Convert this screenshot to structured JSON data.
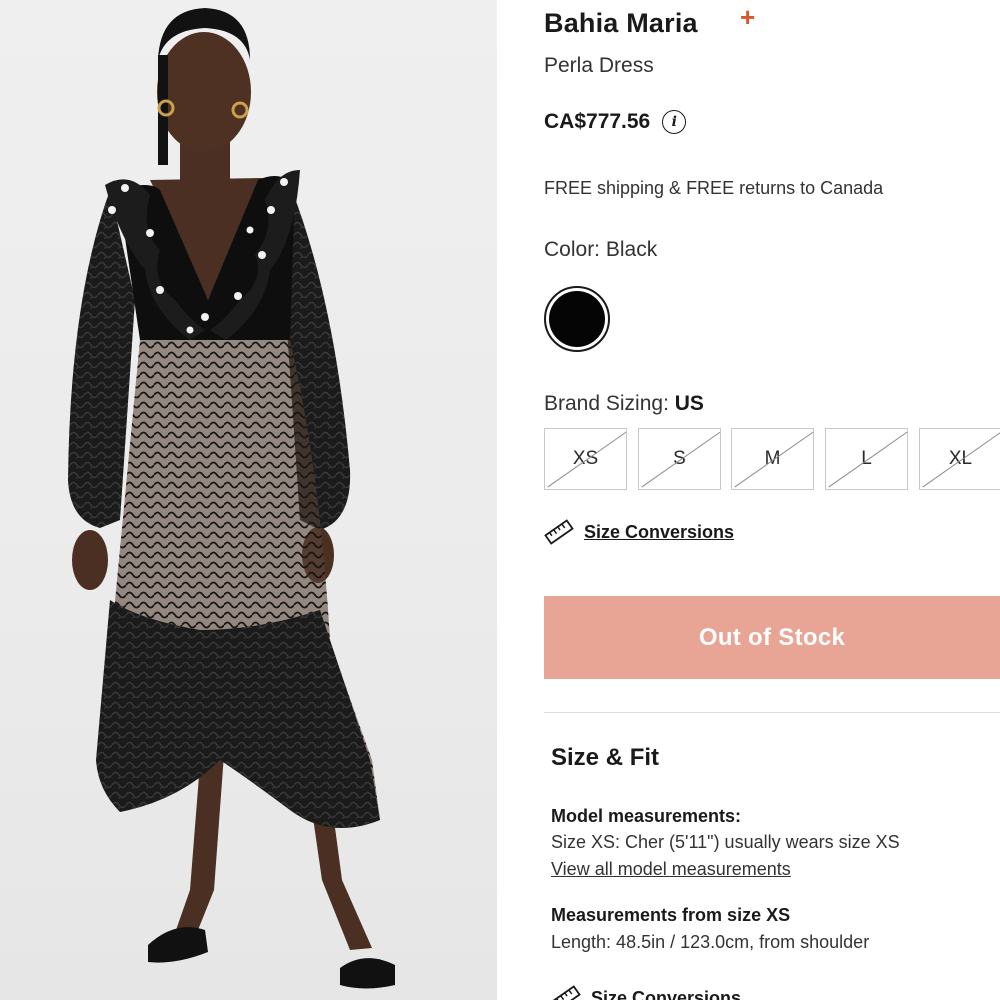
{
  "product": {
    "brand": "Bahia Maria",
    "favorite_icon": "plus-icon",
    "name": "Perla Dress",
    "price": "CA$777.56",
    "price_info_icon": "info-icon",
    "shipping": "FREE shipping & FREE returns to Canada",
    "image_alt": "Model wearing black lace Perla Dress with ruffled V-neck and pearl details"
  },
  "color": {
    "label": "Color: Black",
    "swatch_color": "#050505"
  },
  "sizing": {
    "label_prefix": "Brand Sizing: ",
    "label_value": "US",
    "sizes": [
      {
        "label": "XS",
        "available": false
      },
      {
        "label": "S",
        "available": false
      },
      {
        "label": "M",
        "available": false
      },
      {
        "label": "L",
        "available": false
      },
      {
        "label": "XL",
        "available": false
      }
    ],
    "conversions_link": "Size Conversions"
  },
  "actions": {
    "out_of_stock_label": "Out of Stock",
    "button_color": "#e8a595"
  },
  "size_fit": {
    "title": "Size & Fit",
    "model_heading": "Model measurements:",
    "model_text": "Size XS: Cher (5'11\") usually wears size XS",
    "model_link": "View all model measurements",
    "measurements_heading": "Measurements from size XS",
    "measurements_text": "Length: 48.5in / 123.0cm, from shoulder",
    "conversions_link": "Size Conversions"
  },
  "colors": {
    "accent": "#d9572b",
    "text": "#1a1a1a"
  }
}
